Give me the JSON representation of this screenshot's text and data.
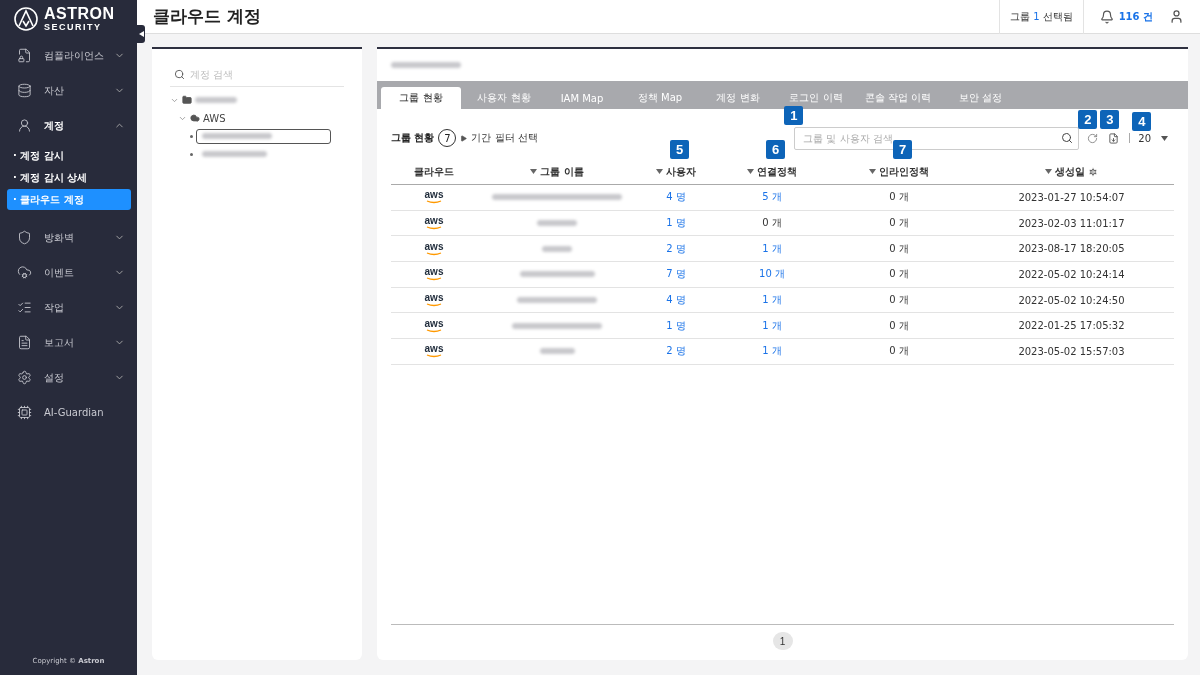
{
  "sidebar": {
    "brand": "ASTRON",
    "brand_sub": "SECURITY",
    "items": [
      {
        "kind": "compliance",
        "label": "컴플라이언스",
        "expanded": false
      },
      {
        "kind": "assets",
        "label": "자산",
        "expanded": false
      },
      {
        "kind": "account",
        "label": "계정",
        "expanded": true,
        "children": [
          {
            "label": "· 계정 감시",
            "selected": false
          },
          {
            "label": "· 계정 감시 상세",
            "selected": false
          },
          {
            "label": "· 클라우드 계정",
            "selected": true
          }
        ]
      },
      {
        "kind": "firewall",
        "label": "방화벽",
        "expanded": false
      },
      {
        "kind": "event",
        "label": "이벤트",
        "expanded": false
      },
      {
        "kind": "task",
        "label": "작업",
        "expanded": false
      },
      {
        "kind": "report",
        "label": "보고서",
        "expanded": false
      },
      {
        "kind": "settings",
        "label": "설정",
        "expanded": false
      },
      {
        "kind": "ai",
        "label": "AI-Guardian"
      }
    ],
    "copyright": "Copyright © **Astron**"
  },
  "header": {
    "title": "클라우드 계정",
    "selection": {
      "prefix": "그룹",
      "count": "1",
      "suffix": "선택됨"
    },
    "alerts": "116 건"
  },
  "tree": {
    "search": {
      "placeholder": "계정 검색"
    },
    "nodes": [
      {
        "kind": "folder",
        "expanded": true,
        "children": [
          {
            "kind": "cloud",
            "label": "AWS",
            "expanded": true,
            "children": [
              {
                "kind": "leaf",
                "selected": true
              },
              {
                "kind": "leaf",
                "selected": false
              }
            ]
          }
        ]
      }
    ]
  },
  "tabs": [
    {
      "label": "그룹 현황",
      "selected": true
    },
    {
      "label": "사용자 현황",
      "selected": false
    },
    {
      "label": "IAM Map",
      "selected": false
    },
    {
      "label": "정책 Map",
      "selected": false
    },
    {
      "label": "계정 변화",
      "selected": false
    },
    {
      "label": "로그인 이력",
      "selected": false
    },
    {
      "label": "콘솔 작업 이력",
      "selected": false
    },
    {
      "label": "보안 설정",
      "selected": false
    }
  ],
  "toolbar": {
    "title": "그룹 현황",
    "count": "7",
    "filter": "기간 필터 선택",
    "search": {
      "placeholder": "그룹 및 사용자 검색",
      "callout": "1"
    },
    "refresh": {
      "callout": "2"
    },
    "export": {
      "callout": "3"
    },
    "page_size": {
      "value": "20",
      "callout": "4"
    }
  },
  "table": {
    "columns": [
      {
        "label": "클라우드",
        "sortable": false
      },
      {
        "label": "그룹 이름",
        "sortable": true
      },
      {
        "label": "사용자",
        "sortable": true,
        "callout": "5"
      },
      {
        "label": "연결정책",
        "sortable": true,
        "callout": "6"
      },
      {
        "label": "인라인정책",
        "sortable": true,
        "callout": "7"
      },
      {
        "label": "생성일",
        "sortable": true,
        "settings": true
      }
    ],
    "rows": [
      {
        "cloud": "aws",
        "users": {
          "text": "4 명",
          "link": true
        },
        "policies": {
          "text": "5 개",
          "link": true
        },
        "inline": "0 개",
        "created": "2023-01-27 10:54:07"
      },
      {
        "cloud": "aws",
        "users": {
          "text": "1 명",
          "link": true
        },
        "policies": {
          "text": "0 개",
          "link": false
        },
        "inline": "0 개",
        "created": "2023-02-03 11:01:17"
      },
      {
        "cloud": "aws",
        "users": {
          "text": "2 명",
          "link": true
        },
        "policies": {
          "text": "1 개",
          "link": true
        },
        "inline": "0 개",
        "created": "2023-08-17 18:20:05"
      },
      {
        "cloud": "aws",
        "users": {
          "text": "7 명",
          "link": true
        },
        "policies": {
          "text": "10 개",
          "link": true
        },
        "inline": "0 개",
        "created": "2022-05-02 10:24:14"
      },
      {
        "cloud": "aws",
        "users": {
          "text": "4 명",
          "link": true
        },
        "policies": {
          "text": "1 개",
          "link": true
        },
        "inline": "0 개",
        "created": "2022-05-02 10:24:50"
      },
      {
        "cloud": "aws",
        "users": {
          "text": "1 명",
          "link": true
        },
        "policies": {
          "text": "1 개",
          "link": true
        },
        "inline": "0 개",
        "created": "2022-01-25 17:05:32"
      },
      {
        "cloud": "aws",
        "users": {
          "text": "2 명",
          "link": true
        },
        "policies": {
          "text": "1 개",
          "link": true
        },
        "inline": "0 개",
        "created": "2023-05-02 15:57:03"
      }
    ]
  },
  "pagination": [
    {
      "label": "1",
      "selected": true
    }
  ]
}
